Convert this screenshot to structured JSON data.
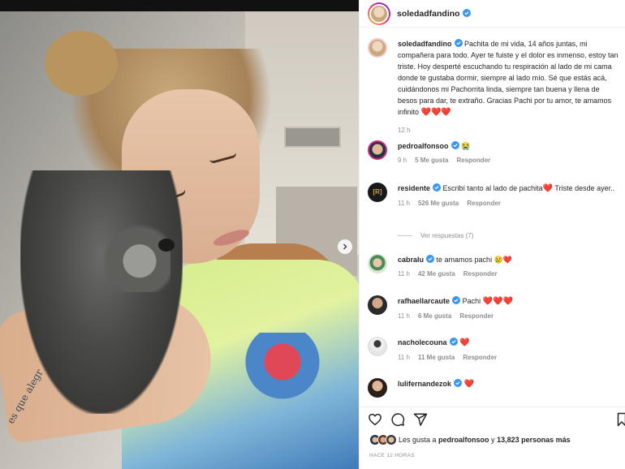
{
  "post": {
    "username": "soledadfandino",
    "caption": "Pachita de mi vida, 14 años juntas, mi compañera para todo. Ayer te fuiste y el dolor es inmenso, estoy tan triste. Hoy desperté escuchando tu respiración al lado de mi cama donde te gustaba dormir, siempre al lado mío. Sé que estás acá, cuidándonos mi Pachorrita linda, siempre tan buena y llena de besos para dar, te extraño. Gracias Pachi por tu amor, te amamos infinito",
    "caption_hearts": "❤️❤️❤️",
    "caption_time": "12 h",
    "tattoo_text": "es que alegr"
  },
  "comments": [
    {
      "user": "pedroalfonsoo",
      "text": "",
      "emoji": "😭",
      "time": "9 h",
      "likes": "5 Me gusta",
      "reply": "Responder"
    },
    {
      "user": "residente",
      "text": "Escribí tanto al lado de pachita",
      "emoji": "❤️",
      "text2": " Triste desde ayer..",
      "time": "11 h",
      "likes": "526 Me gusta",
      "reply": "Responder",
      "view_replies": "Ver respuestas (7)"
    },
    {
      "user": "cabralu",
      "text": "te amamos pachi",
      "emoji": "😢❤️",
      "time": "11 h",
      "likes": "42 Me gusta",
      "reply": "Responder"
    },
    {
      "user": "rafhaellarcaute",
      "text": "Pachi",
      "emoji": "❤️❤️❤️",
      "time": "11 h",
      "likes": "6 Me gusta",
      "reply": "Responder"
    },
    {
      "user": "nacholecouna",
      "text": "",
      "emoji": "❤️",
      "time": "11 h",
      "likes": "11 Me gusta",
      "reply": "Responder"
    },
    {
      "user": "lulifernandezok",
      "text": "",
      "emoji": "❤️",
      "time": "",
      "likes": "",
      "reply": ""
    }
  ],
  "footer": {
    "likes_prefix": "Les gusta a ",
    "likes_user": "pedroalfonsoo",
    "likes_mid": " y ",
    "likes_count": "13,823 personas más",
    "timestamp": "HACE 12 HORAS"
  },
  "icons": {
    "like": "heart-outline-icon",
    "comment": "comment-icon",
    "share": "paper-plane-icon",
    "save": "bookmark-icon",
    "verified": "verified-badge-icon",
    "next": "chevron-right-icon"
  },
  "colors": {
    "verified": "#3897f0",
    "heart": "#ed1c3b",
    "muted": "#8e8e8e"
  }
}
